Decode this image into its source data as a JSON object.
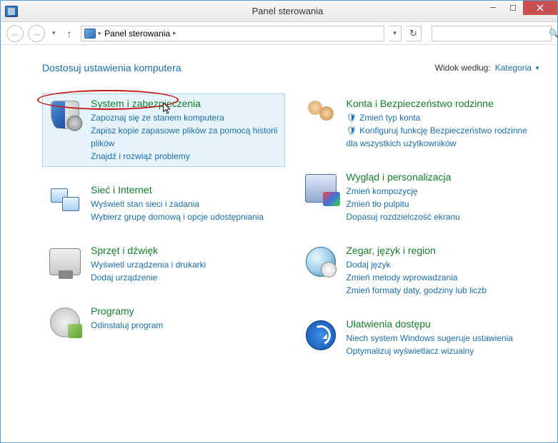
{
  "window": {
    "title": "Panel sterowania"
  },
  "breadcrumb": {
    "location": "Panel sterowania"
  },
  "search": {
    "placeholder": ""
  },
  "page": {
    "heading": "Dostosuj ustawienia komputera",
    "view_label": "Widok według:",
    "view_value": "Kategoria"
  },
  "left": [
    {
      "title": "System i zabezpieczenia",
      "links": [
        "Zapoznaj się ze stanem komputera",
        "Zapisz kopie zapasowe plików za pomocą historii plików",
        "Znajdź i rozwiąż problemy"
      ]
    },
    {
      "title": "Sieć i Internet",
      "links": [
        "Wyświetl stan sieci i zadania",
        "Wybierz grupę domową i opcje udostępniania"
      ]
    },
    {
      "title": "Sprzęt i dźwięk",
      "links": [
        "Wyświetl urządzenia i drukarki",
        "Dodaj urządzenie"
      ]
    },
    {
      "title": "Programy",
      "links": [
        "Odinstaluj program"
      ]
    }
  ],
  "right": [
    {
      "title": "Konta i Bezpieczeństwo rodzinne",
      "links": [
        "🛡 Zmień typ konta",
        "🛡 Konfiguruj funkcję Bezpieczeństwo rodzinne dla wszystkich użytkowników"
      ]
    },
    {
      "title": "Wygląd i personalizacja",
      "links": [
        "Zmień kompozycję",
        "Zmień tło pulpitu",
        "Dopasuj rozdzielczość ekranu"
      ]
    },
    {
      "title": "Zegar, język i region",
      "links": [
        "Dodaj język",
        "Zmień metody wprowadzania",
        "Zmień formaty daty, godziny lub liczb"
      ]
    },
    {
      "title": "Ułatwienia dostępu",
      "links": [
        "Niech system Windows sugeruje ustawienia",
        "Optymalizuj wyświetlacz wizualny"
      ]
    }
  ]
}
